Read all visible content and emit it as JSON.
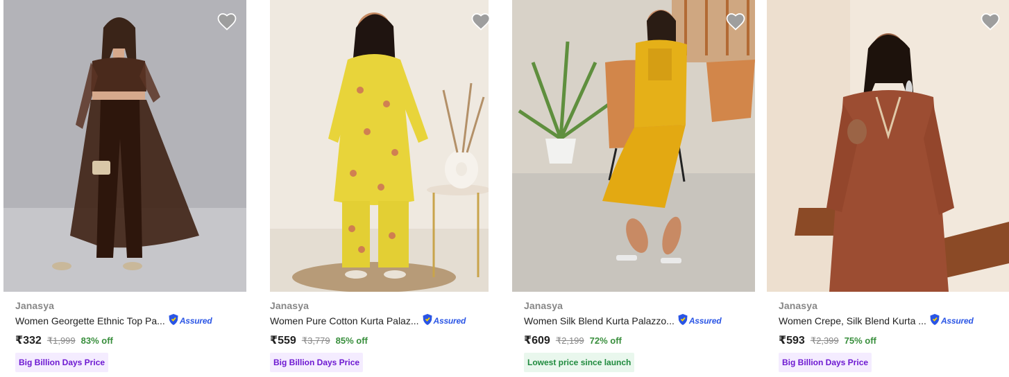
{
  "products": [
    {
      "brand": "Janasya",
      "title": "Women Georgette Ethnic Top Pa...",
      "assured_label": "Assured",
      "price": "₹332",
      "mrp": "₹1,999",
      "discount": "83% off",
      "badge": "Big Billion Days Price",
      "badge_type": "purple",
      "image_alt": "Women wearing brown georgette ethnic top and palazzo set"
    },
    {
      "brand": "Janasya",
      "title": "Women Pure Cotton Kurta Palaz...",
      "assured_label": "Assured",
      "price": "₹559",
      "mrp": "₹3,779",
      "discount": "85% off",
      "badge": "Big Billion Days Price",
      "badge_type": "purple",
      "image_alt": "Women wearing yellow floral cotton kurta palazzo set"
    },
    {
      "brand": "Janasya",
      "title": "Women Silk Blend Kurta Palazzo...",
      "assured_label": "Assured",
      "price": "₹609",
      "mrp": "₹2,199",
      "discount": "72% off",
      "badge": "Lowest price since launch",
      "badge_type": "green",
      "image_alt": "Women wearing mustard silk blend kurta palazzo set"
    },
    {
      "brand": "Janasya",
      "title": "Women Crepe, Silk Blend Kurta ...",
      "assured_label": "Assured",
      "price": "₹593",
      "mrp": "₹2,399",
      "discount": "75% off",
      "badge": "Big Billion Days Price",
      "badge_type": "purple",
      "image_alt": "Women wearing rust crepe silk blend kurta"
    }
  ],
  "colors": {
    "discount": "#388e3c",
    "assured": "#2a55e5",
    "badge_purple_bg": "#f4ecff",
    "badge_purple_text": "#6d19d1",
    "badge_green_bg": "#e9f7ed",
    "badge_green_text": "#1f8a3d"
  },
  "icons": {
    "wishlist": "heart-icon",
    "assured": "flipkart-assured-icon"
  }
}
